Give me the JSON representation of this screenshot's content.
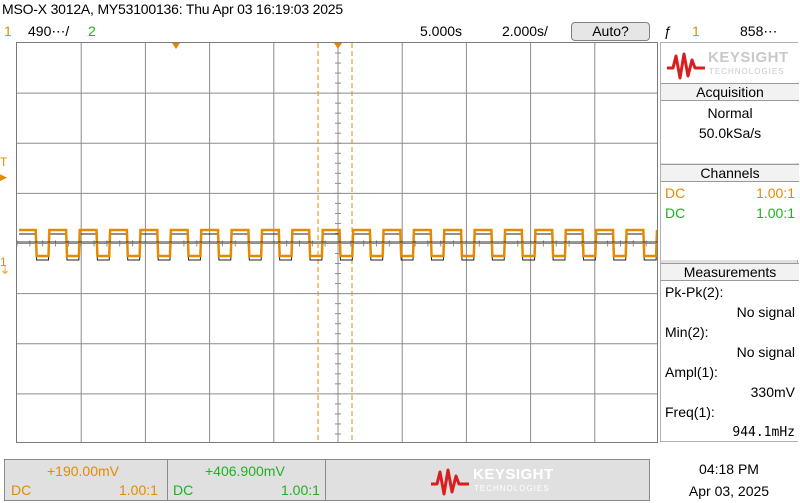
{
  "title": "MSO-X 3012A, MY53100136: Thu Apr 03 16:19:03 2025",
  "status_bar": {
    "ch1_num": "1",
    "ch1_scale": "490⋯/",
    "ch2_num": "2",
    "timebase": "5.000s",
    "delay": "2.000s/",
    "auto_label": "Auto?",
    "trigger_icon": "ƒ",
    "trigger_source": "1",
    "trigger_level": "858⋯"
  },
  "colors": {
    "ch1": "#e58a00",
    "ch2": "#20b020",
    "brand": "#d81e1e"
  },
  "left_markers": {
    "trigger_mark": "T",
    "ground_mark": "1"
  },
  "brand": {
    "name": "KEYSIGHT",
    "sub": "TECHNOLOGIES"
  },
  "acquisition": {
    "header": "Acquisition",
    "mode": "Normal",
    "rate": "50.0kSa/s"
  },
  "channels": {
    "header": "Channels",
    "items": [
      {
        "coupling": "DC",
        "scale": "1.00:1"
      },
      {
        "coupling": "DC",
        "scale": "1.00:1"
      }
    ]
  },
  "measurements": {
    "header": "Measurements",
    "items": [
      {
        "name": "Pk-Pk(2):",
        "value": "No signal"
      },
      {
        "name": "Min(2):",
        "value": "No signal"
      },
      {
        "name": "Ampl(1):",
        "value": "330mV"
      },
      {
        "name": "Freq(1):",
        "value": "944.1mHz"
      }
    ]
  },
  "bottom": {
    "ch1_offset": "+190.00mV",
    "ch1_coupling": "DC",
    "ch1_probe": "1.00:1",
    "ch2_offset": "+406.900mV",
    "ch2_coupling": "DC",
    "ch2_probe": "1.00:1"
  },
  "clock": {
    "time": "04:18 PM",
    "date": "Apr 03, 2025"
  },
  "waveform": {
    "description_only_for_render": "square",
    "cycles": 21,
    "high_level": 0.5,
    "low_level": -0.35
  }
}
